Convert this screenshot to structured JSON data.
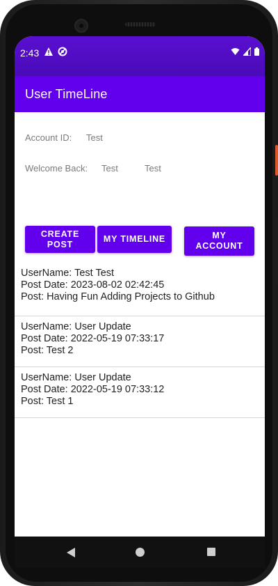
{
  "status_bar": {
    "time": "2:43",
    "left_icons": [
      "warning-icon",
      "circle-slash-icon"
    ],
    "right_icons": [
      "wifi-icon",
      "signal-icon",
      "battery-icon"
    ]
  },
  "app_bar": {
    "title": "User TimeLine"
  },
  "account": {
    "id_label": "Account ID:",
    "id_value": "Test",
    "welcome_label": "Welcome Back:",
    "first_name": "Test",
    "last_name": "Test"
  },
  "buttons": {
    "create_post": "CREATE POST",
    "my_timeline": "MY TIMELINE",
    "my_account": "MY ACCOUNT"
  },
  "posts": [
    {
      "username": "UserName: Test Test",
      "date": "Post Date: 2023-08-02 02:42:45",
      "text": "Post: Having Fun Adding Projects to Github"
    },
    {
      "username": "UserName: User Update",
      "date": "Post Date: 2022-05-19 07:33:17",
      "text": "Post: Test 2"
    },
    {
      "username": "UserName: User Update",
      "date": "Post Date: 2022-05-19 07:33:12",
      "text": "Post: Test 1"
    }
  ],
  "nav_bar": {
    "icons": [
      "back-icon",
      "home-icon",
      "recents-icon"
    ]
  },
  "colors": {
    "primary": "#6200ee",
    "status_bar": "#5a0fd0"
  }
}
